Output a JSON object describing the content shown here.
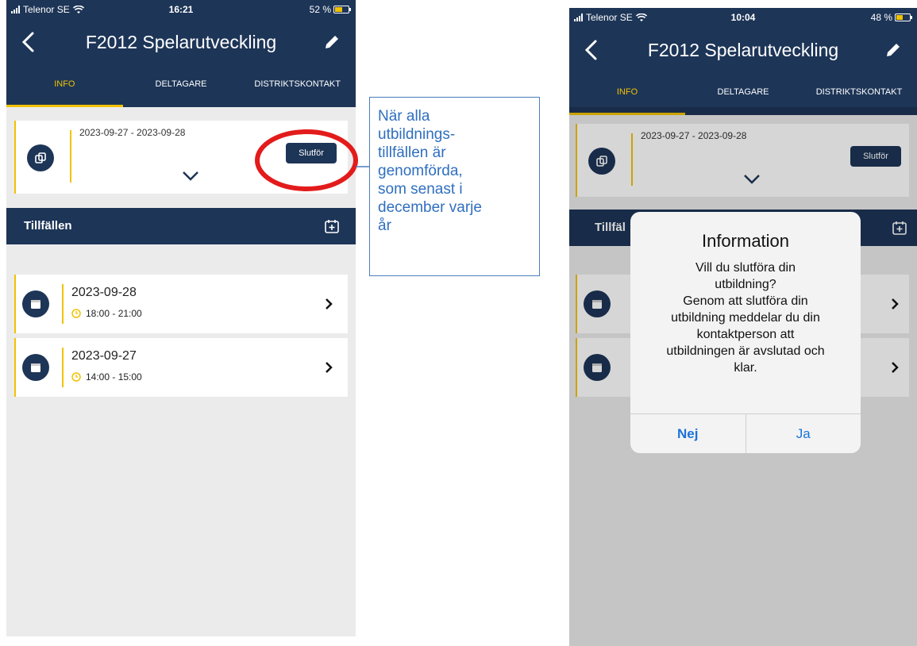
{
  "colors": {
    "header_bg": "#1d3557",
    "accent": "#f2c200",
    "callout_text": "#2f6fbf",
    "ios_blue": "#1a73d9"
  },
  "left_screen": {
    "status": {
      "carrier": "Telenor SE",
      "time": "16:21",
      "battery": "52 %"
    },
    "title": "F2012 Spelarutveckling",
    "tabs": [
      "INFO",
      "DELTAGARE",
      "DISTRIKTSKONTAKT"
    ],
    "active_tab": "INFO",
    "card": {
      "date_range": "2023-09-27 - 2023-09-28",
      "finish_button": "Slutför"
    },
    "section_title": "Tillfällen",
    "sessions": [
      {
        "date": "2023-09-28",
        "time": "18:00 - 21:00"
      },
      {
        "date": "2023-09-27",
        "time": "14:00 - 15:00"
      }
    ]
  },
  "callout": {
    "lines": [
      "När alla",
      "utbildnings-",
      "tillfällen är",
      "genomförda,",
      "som senast i",
      "december varje",
      "år"
    ]
  },
  "right_screen": {
    "status": {
      "carrier": "Telenor SE",
      "time": "10:04",
      "battery": "48 %"
    },
    "title": "F2012 Spelarutveckling",
    "tabs": [
      "INFO",
      "DELTAGARE",
      "DISTRIKTSKONTAKT"
    ],
    "card": {
      "date_range": "2023-09-27 - 2023-09-28",
      "finish_button": "Slutför"
    },
    "section_title": "Tillfäl",
    "dialog": {
      "title": "Information",
      "message_lines": [
        "Vill du slutföra din",
        "utbildning?",
        "Genom att slutföra din",
        "utbildning meddelar du din",
        "kontaktperson att",
        "utbildningen är avslutad och",
        "klar."
      ],
      "no": "Nej",
      "yes": "Ja"
    }
  }
}
